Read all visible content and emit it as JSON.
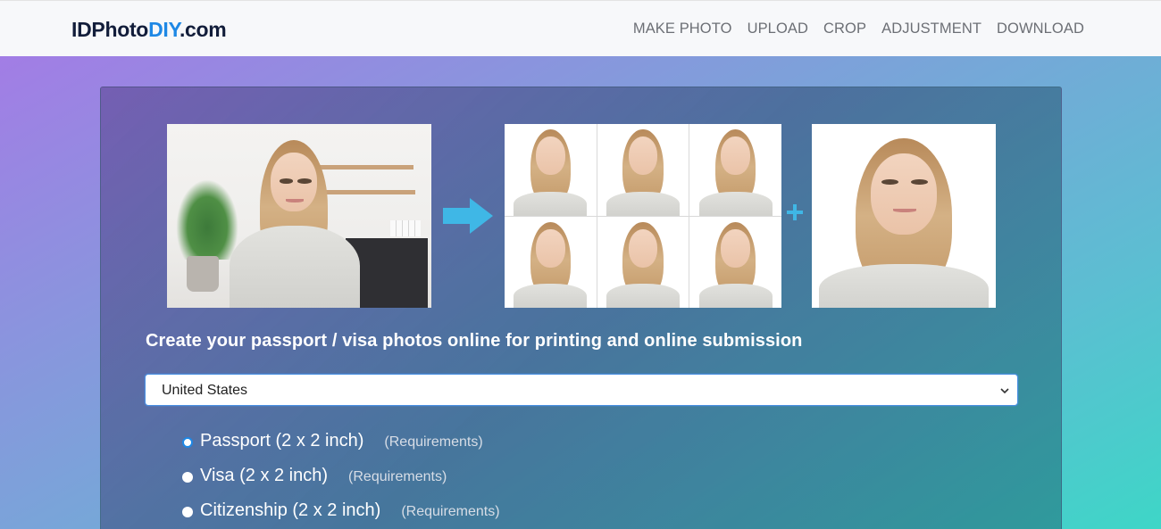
{
  "brand": {
    "logo_part1": "IDPhoto",
    "logo_part2": "DIY",
    "logo_part3": ".com",
    "accent_color": "#1e88e5"
  },
  "nav": {
    "items": [
      {
        "label": "MAKE PHOTO"
      },
      {
        "label": "UPLOAD"
      },
      {
        "label": "CROP"
      },
      {
        "label": "ADJUSTMENT"
      },
      {
        "label": "DOWNLOAD"
      }
    ]
  },
  "hero": {
    "tagline": "Create your passport / visa photos online for printing and online submission",
    "illustration": {
      "arrow_icon": "arrow-right-icon",
      "plus_icon": "plus-icon",
      "arrow_color": "#3fb7e6"
    }
  },
  "country_select": {
    "selected": "United States"
  },
  "photo_types": [
    {
      "label": "Passport (2 x 2 inch)",
      "requirements": "(Requirements)",
      "selected": true
    },
    {
      "label": "Visa (2 x 2 inch)",
      "requirements": "(Requirements)",
      "selected": false
    },
    {
      "label": "Citizenship (2 x 2 inch)",
      "requirements": "(Requirements)",
      "selected": false
    }
  ]
}
